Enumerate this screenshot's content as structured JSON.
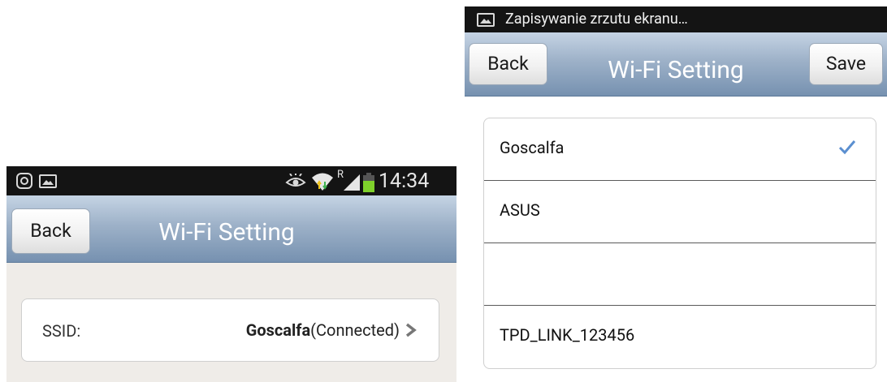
{
  "left_screen": {
    "status_bar": {
      "time": "14:34",
      "icons": [
        "screen-capture-icon",
        "image-icon",
        "eye-icon",
        "wifi-icon",
        "roaming-indicator",
        "signal-icon",
        "battery-icon"
      ],
      "roaming": "R"
    },
    "navbar": {
      "back_label": "Back",
      "title": "Wi-Fi Setting"
    },
    "ssid_card": {
      "label": "SSID:",
      "network": "Goscalfa",
      "status": "(Connected)"
    }
  },
  "right_screen": {
    "status_bar": {
      "notification": "Zapisywanie zrzutu ekranu…"
    },
    "navbar": {
      "back_label": "Back",
      "title": "Wi-Fi Setting",
      "save_label": "Save"
    },
    "networks": [
      {
        "name": "Goscalfa",
        "selected": true
      },
      {
        "name": "ASUS",
        "selected": false
      },
      {
        "name": "",
        "selected": false
      },
      {
        "name": "TPD_LINK_123456",
        "selected": false
      }
    ]
  },
  "colors": {
    "status_bar": "#141414",
    "navbar_top": "#c5d4e4",
    "navbar_bottom": "#7691b0",
    "page_background": "#efece8",
    "checkmark": "#5b8fd0",
    "battery": "#7fd12b"
  }
}
